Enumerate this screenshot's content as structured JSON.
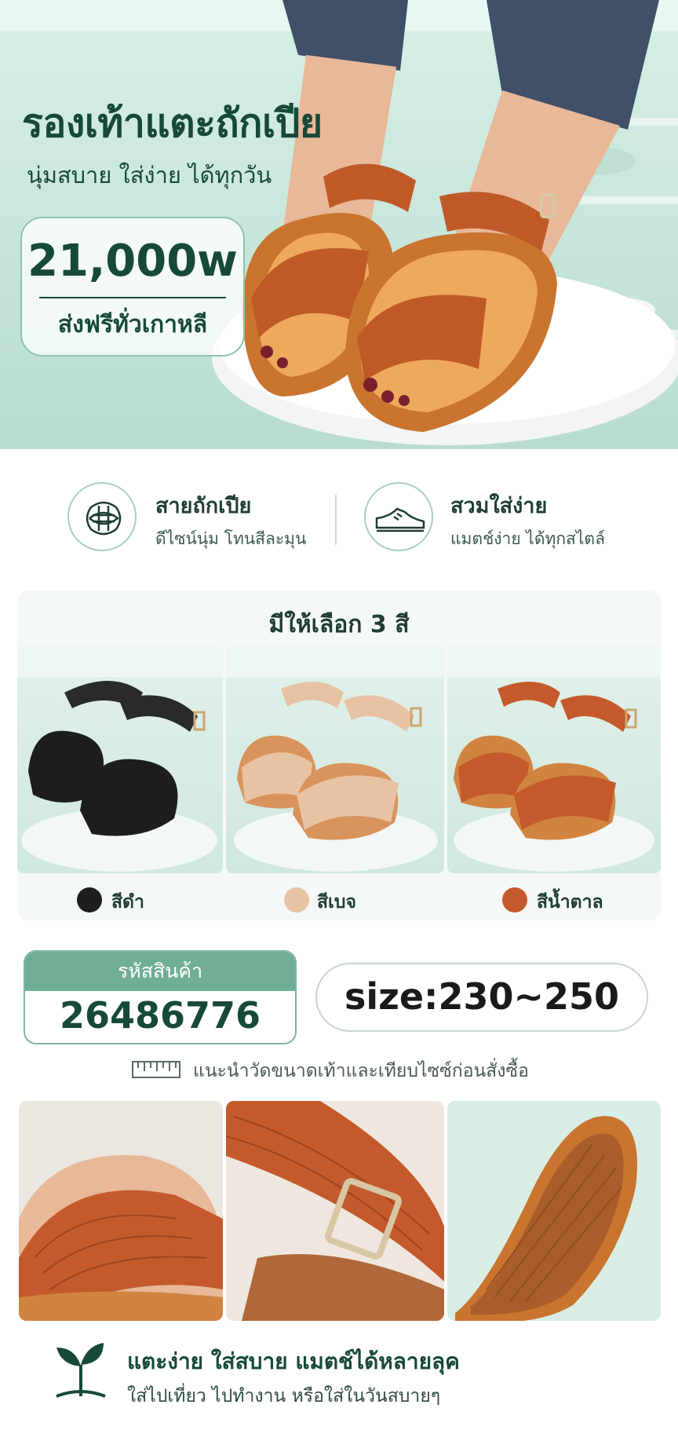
{
  "hero": {
    "title": "รองเท้าแตะถักเปีย",
    "subtitle": "นุ่มสบาย ใส่ง่าย ได้ทุกวัน",
    "price": "21,000w",
    "shipping": "ส่งฟรีทั่วเกาหลี"
  },
  "features": [
    {
      "icon": "braid-knot-icon",
      "title": "สายถักเปีย",
      "desc": "ดีไซน์นุ่ม โทนสีละมุน"
    },
    {
      "icon": "sneaker-icon",
      "title": "สวมใส่ง่าย",
      "desc": "แมตช์ง่าย ได้ทุกสไตล์"
    }
  ],
  "colors": {
    "heading": "มีให้เลือก 3 สี",
    "options": [
      {
        "name": "สีดำ",
        "hex": "#1d1d1d"
      },
      {
        "name": "สีเบจ",
        "hex": "#e7c3a4"
      },
      {
        "name": "สีน้ำตาล",
        "hex": "#c45a2c"
      }
    ]
  },
  "product": {
    "code_label": "รหัสสินค้า",
    "code": "26486776",
    "size": "size:230~250",
    "measure_note": "แนะนำวัดขนาดเท้าและเทียบไซซ์ก่อนสั่งซื้อ"
  },
  "footer": {
    "title": "แตะง่าย ใส่สบาย แมตช์ได้หลายลุค",
    "subtitle": "ใส่ไปเที่ยว ไปทำงาน หรือใส่ในวันสบายๆ"
  },
  "theme": {
    "primary": "#17493b",
    "accent": "#6fae95",
    "mint": "#c7e6da",
    "sandal_brown": "#c45a2c"
  }
}
